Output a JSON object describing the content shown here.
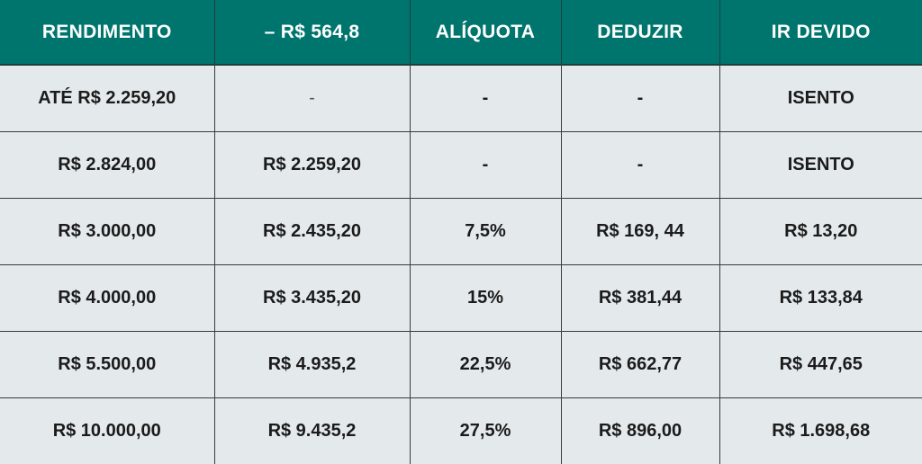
{
  "table": {
    "headers": [
      "RENDIMENTO",
      "– R$ 564,8",
      "ALÍQUOTA",
      "DEDUZIR",
      "IR DEVIDO"
    ],
    "rows": [
      [
        "ATÉ R$ 2.259,20",
        "-",
        "-",
        "-",
        "ISENTO"
      ],
      [
        "R$ 2.824,00",
        "R$ 2.259,20",
        "-",
        "-",
        "ISENTO"
      ],
      [
        "R$ 3.000,00",
        "R$ 2.435,20",
        "7,5%",
        "R$ 169, 44",
        "R$ 13,20"
      ],
      [
        "R$ 4.000,00",
        "R$ 3.435,20",
        "15%",
        "R$ 381,44",
        "R$ 133,84"
      ],
      [
        "R$ 5.500,00",
        "R$ 4.935,2",
        "22,5%",
        "R$ 662,77",
        "R$ 447,65"
      ],
      [
        "R$ 10.000,00",
        "R$ 9.435,2",
        "27,5%",
        "R$ 896,00",
        "R$ 1.698,68"
      ]
    ]
  },
  "colors": {
    "header_bg": "#00756d",
    "header_text": "#ffffff",
    "body_bg": "#e4eaec",
    "body_text": "#1b1b1b"
  }
}
